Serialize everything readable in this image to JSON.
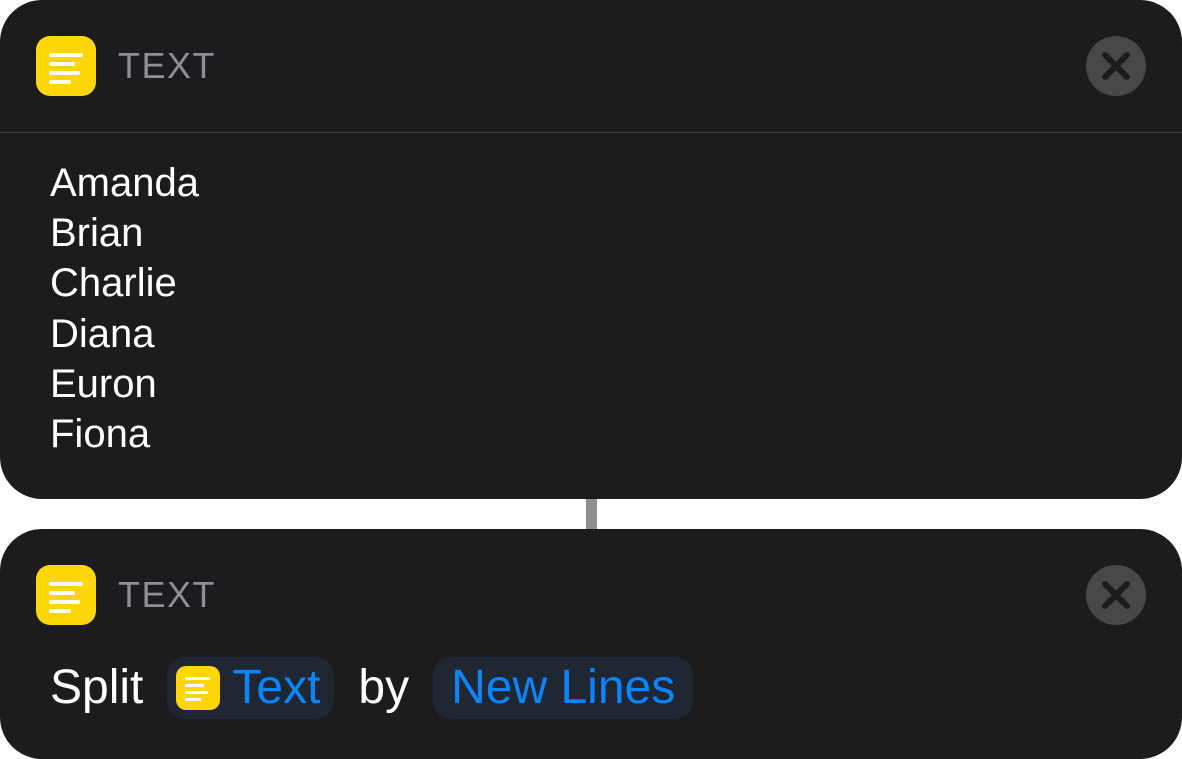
{
  "colors": {
    "card_background": "#1c1c1e",
    "icon_yellow": "#ffd60a",
    "accent_blue": "#0a84ff",
    "header_gray": "#8e8e93",
    "close_button_gray": "#48484a"
  },
  "text_action": {
    "icon": "text-lines-icon",
    "title": "TEXT",
    "close_icon": "close-x-icon",
    "lines": [
      "Amanda",
      "Brian",
      "Charlie",
      "Diana",
      "Euron",
      "Fiona"
    ]
  },
  "split_action": {
    "icon": "text-lines-icon",
    "title": "TEXT",
    "close_icon": "close-x-icon",
    "verb": "Split",
    "input_variable": {
      "icon": "text-lines-icon",
      "label": "Text"
    },
    "preposition": "by",
    "separator": "New Lines"
  }
}
